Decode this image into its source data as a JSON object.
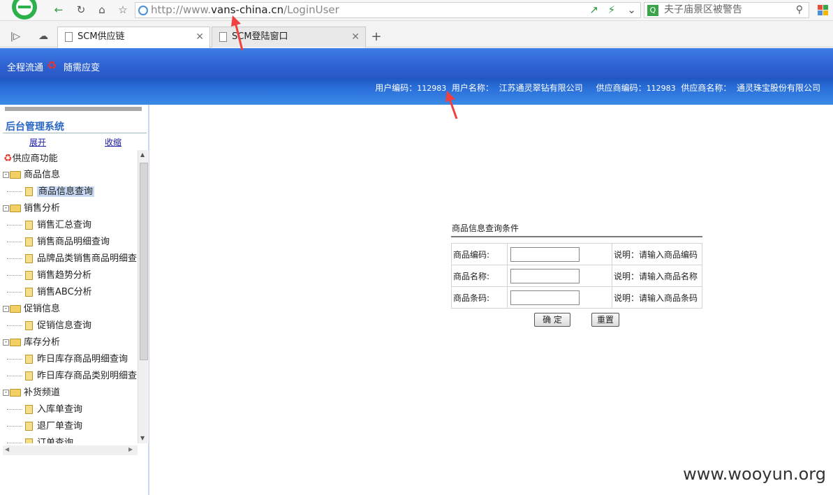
{
  "browser": {
    "url_prefix": "http://www.",
    "url_domain": "vans-china.cn",
    "url_path": "/LoginUser",
    "search_text": "夫子庙景区被警告",
    "tabs": [
      {
        "label": "SCM供应链"
      },
      {
        "label": "SCM登陆窗口"
      }
    ],
    "new_tab_label": "+"
  },
  "header": {
    "slogan_left": "全程流通",
    "slogan_right": "随需应变",
    "user_code_label": "用户编码：",
    "user_code": "112983",
    "user_name_label": "用户名称：",
    "user_name": "江苏通灵翠钻有限公司",
    "supplier_code_label": "供应商编码：",
    "supplier_code": "112983",
    "supplier_name_label": "供应商名称：",
    "supplier_name": "通灵珠宝股份有限公司"
  },
  "sidebar": {
    "title": "后台管理系统",
    "expand": "展开",
    "collapse": "收缩",
    "root": "供应商功能",
    "items": [
      {
        "label": "商品信息",
        "type": "folder"
      },
      {
        "label": "商品信息查询",
        "type": "page"
      },
      {
        "label": "销售分析",
        "type": "folder"
      },
      {
        "label": "销售汇总查询",
        "type": "page"
      },
      {
        "label": "销售商品明细查询",
        "type": "page"
      },
      {
        "label": "品牌品类销售商品明细查",
        "type": "page"
      },
      {
        "label": "销售趋势分析",
        "type": "page"
      },
      {
        "label": "销售ABC分析",
        "type": "page"
      },
      {
        "label": "促销信息",
        "type": "folder"
      },
      {
        "label": "促销信息查询",
        "type": "page"
      },
      {
        "label": "库存分析",
        "type": "folder"
      },
      {
        "label": "昨日库存商品明细查询",
        "type": "page"
      },
      {
        "label": "昨日库存商品类别明细查",
        "type": "page"
      },
      {
        "label": "补货频道",
        "type": "folder"
      },
      {
        "label": "入库单查询",
        "type": "page"
      },
      {
        "label": "退厂单查询",
        "type": "page"
      },
      {
        "label": "订单查询",
        "type": "page"
      }
    ]
  },
  "form": {
    "title": "商品信息查询条件",
    "rows": [
      {
        "label": "商品编码:",
        "hint": "说明：请输入商品编码"
      },
      {
        "label": "商品名称:",
        "hint": "说明：请输入商品名称"
      },
      {
        "label": "商品条码:",
        "hint": "说明：请输入商品条码"
      }
    ],
    "confirm": "确 定",
    "reset": "重置"
  },
  "watermark": "www.wooyun.org",
  "colors": {
    "banner": "#2f62d2",
    "sidebar_title": "#2b66c4",
    "arrow": "#f04040"
  }
}
